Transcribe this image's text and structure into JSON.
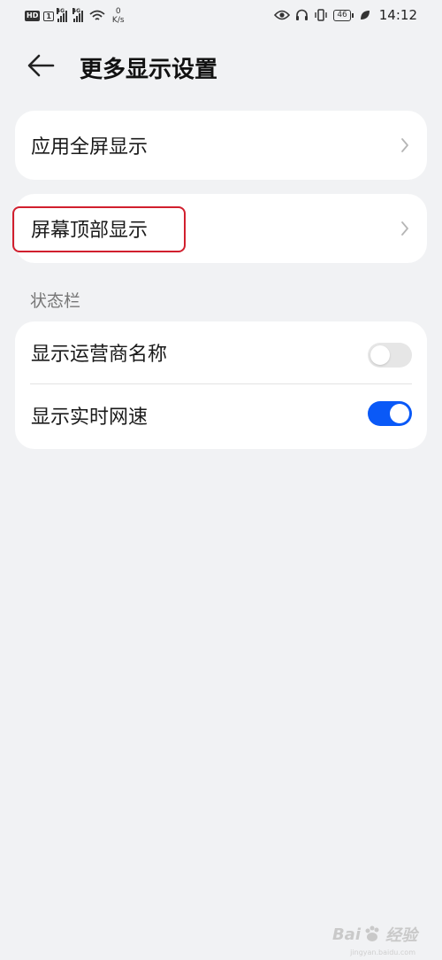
{
  "status_bar": {
    "hd_label": "HD",
    "sim1_label": "1",
    "sig1_tag": "4G",
    "sig2_tag": "4G",
    "net_speed_value": "0",
    "net_speed_unit": "K/s",
    "battery_level": "46",
    "time": "14:12"
  },
  "header": {
    "title": "更多显示设置"
  },
  "items": {
    "fullscreen_label": "应用全屏显示",
    "top_display_label": "屏幕顶部显示"
  },
  "status_section": {
    "label": "状态栏",
    "carrier_name_label": "显示运营商名称",
    "carrier_name_enabled": false,
    "net_speed_label": "显示实时网速",
    "net_speed_enabled": true
  },
  "watermark": {
    "brand_prefix": "Bai",
    "brand_suffix": "经验",
    "url": "jingyan.baidu.com"
  },
  "colors": {
    "accent": "#0a59f7",
    "highlight": "#d11f2e",
    "background": "#f1f2f4"
  }
}
